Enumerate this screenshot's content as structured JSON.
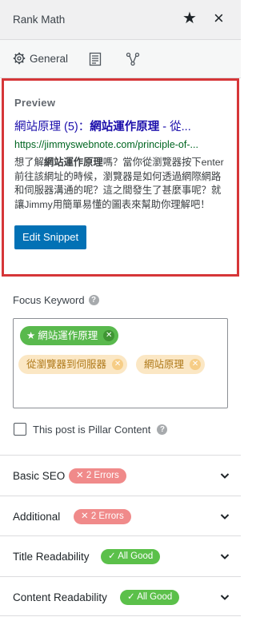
{
  "header": {
    "title": "Rank Math",
    "star_icon": "star-icon",
    "close_icon": "close-icon"
  },
  "tabs": [
    {
      "label": "General",
      "icon": "gear-icon"
    },
    {
      "label": "",
      "icon": "schema-icon"
    },
    {
      "label": "",
      "icon": "social-share-icon"
    }
  ],
  "preview": {
    "label": "Preview",
    "title_pre": "網站原理 ",
    "title_mid": "(5)：",
    "title_bold": "網站運作原理",
    "title_post": " - 從...",
    "url": "https://jimmyswebnote.com/principle-of-...",
    "desc_pre": "想了解",
    "desc_bold": "網站運作原理",
    "desc_post": "嗎？當你從瀏覽器按下enter前往該網址的時候，瀏覽器是如何透過網際網路和伺服器溝通的呢？這之間發生了甚麼事呢？就讓Jimmy用簡單易懂的圖表來幫助你理解吧！",
    "edit_button": "Edit Snippet"
  },
  "focus_keyword": {
    "label": "Focus Keyword",
    "tags": [
      {
        "text": "網站運作原理",
        "primary": true
      },
      {
        "text": "從瀏覽器到伺服器",
        "primary": false
      },
      {
        "text": "網站原理",
        "primary": false
      }
    ]
  },
  "pillar": {
    "label": "This post is Pillar Content"
  },
  "sections": [
    {
      "title": "Basic SEO",
      "badge": "✕ 2 Errors",
      "status": "error"
    },
    {
      "title": "Additional",
      "badge": "✕ 2 Errors",
      "status": "error"
    },
    {
      "title": "Title Readability",
      "badge": "✓ All Good",
      "status": "good"
    },
    {
      "title": "Content Readability",
      "badge": "✓ All Good",
      "status": "good"
    }
  ],
  "colors": {
    "accent": "#0271b5",
    "error": "#f08a8a",
    "good": "#5bc04a",
    "highlight_border": "#d63638"
  }
}
